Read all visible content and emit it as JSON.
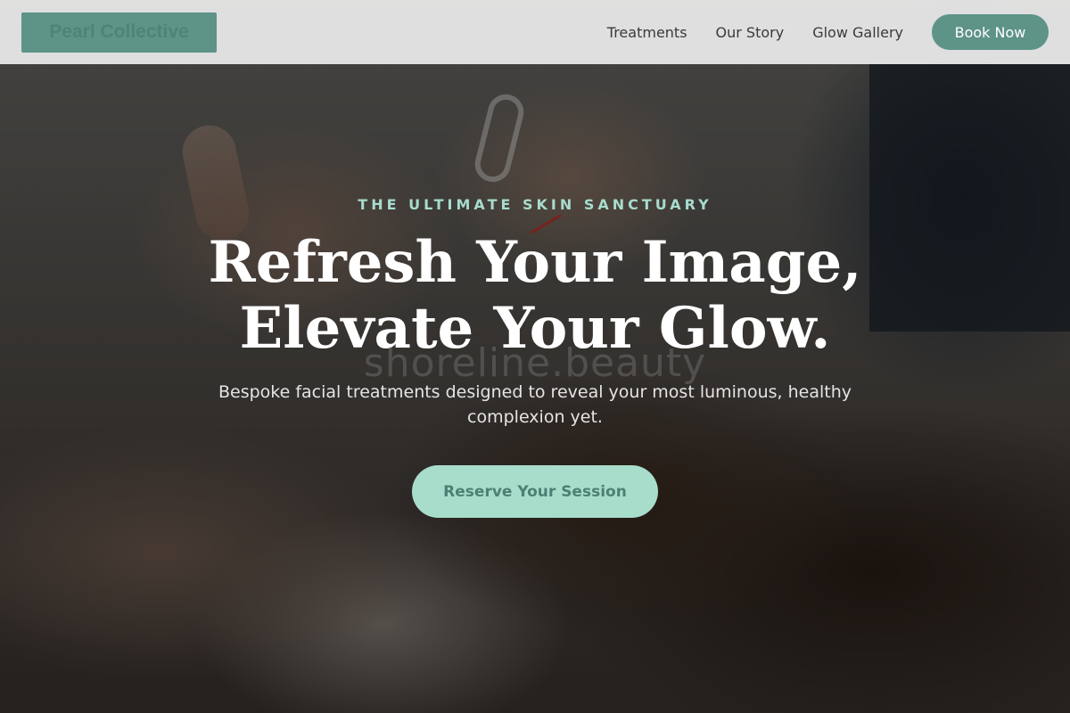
{
  "nav": {
    "brand": "Pearl Collective",
    "links": [
      "Treatments",
      "Our Story",
      "Glow Gallery"
    ],
    "book_label": "Book Now"
  },
  "hero": {
    "eyebrow": "THE ULTIMATE SKIN SANCTUARY",
    "headline_line1": "Refresh Your Image,",
    "headline_line2": "Elevate Your Glow.",
    "watermark": "shoreline.beauty",
    "subtitle": "Bespoke facial treatments designed to reveal your most luminous, healthy complexion yet.",
    "cta_label": "Reserve Your Session"
  },
  "colors": {
    "accent": "#5e9388",
    "accent_light": "#a8dccb",
    "eyebrow": "#a7dccd"
  }
}
